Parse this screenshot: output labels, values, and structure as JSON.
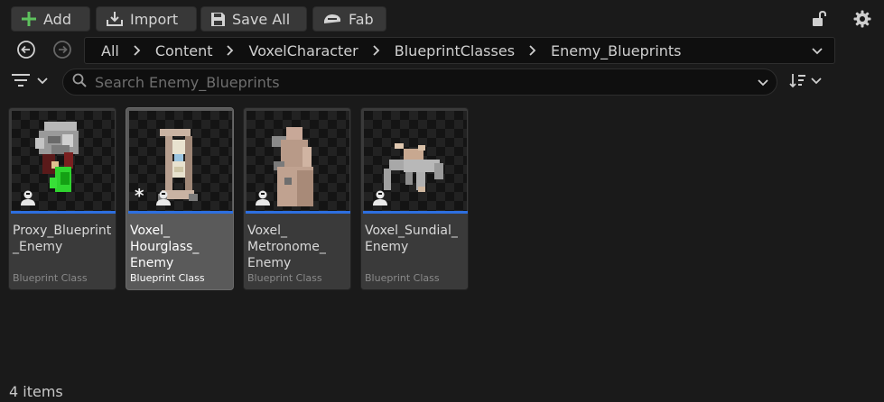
{
  "toolbar": {
    "add_label": "Add",
    "import_label": "Import",
    "save_all_label": "Save All",
    "fab_label": "Fab"
  },
  "icons": {
    "add": "plus-icon",
    "import": "import-icon",
    "save": "save-icon",
    "fab": "fab-icon",
    "lock": "unlock-icon",
    "settings": "gear-icon",
    "back": "back-arrow-icon",
    "forward": "forward-arrow-icon",
    "filter": "filter-icon",
    "search": "search-icon",
    "sort": "sort-icon",
    "blueprint": "blueprint-class-icon"
  },
  "breadcrumb": [
    "All",
    "Content",
    "VoxelCharacter",
    "BlueprintClasses",
    "Enemy_Blueprints"
  ],
  "search": {
    "placeholder": "Search Enemy_Blueprints",
    "value": ""
  },
  "assets": [
    {
      "name": "Proxy_Blueprint\n_Enemy",
      "type": "Blueprint Class",
      "selected": false,
      "modified": false
    },
    {
      "name": "Voxel_\nHourglass_\nEnemy",
      "type": "Blueprint Class",
      "selected": true,
      "modified": true
    },
    {
      "name": "Voxel_\nMetronome_\nEnemy",
      "type": "Blueprint Class",
      "selected": false,
      "modified": false
    },
    {
      "name": "Voxel_Sundial_\nEnemy",
      "type": "Blueprint Class",
      "selected": false,
      "modified": false
    }
  ],
  "status": {
    "item_count": "4 items"
  },
  "colors": {
    "background": "#1a1a1a",
    "tile": "#3a3a3a",
    "tile_selected": "#5a5a5a",
    "blueprint_accent": "#2d6fe0",
    "add_plus": "#5ec25e"
  }
}
